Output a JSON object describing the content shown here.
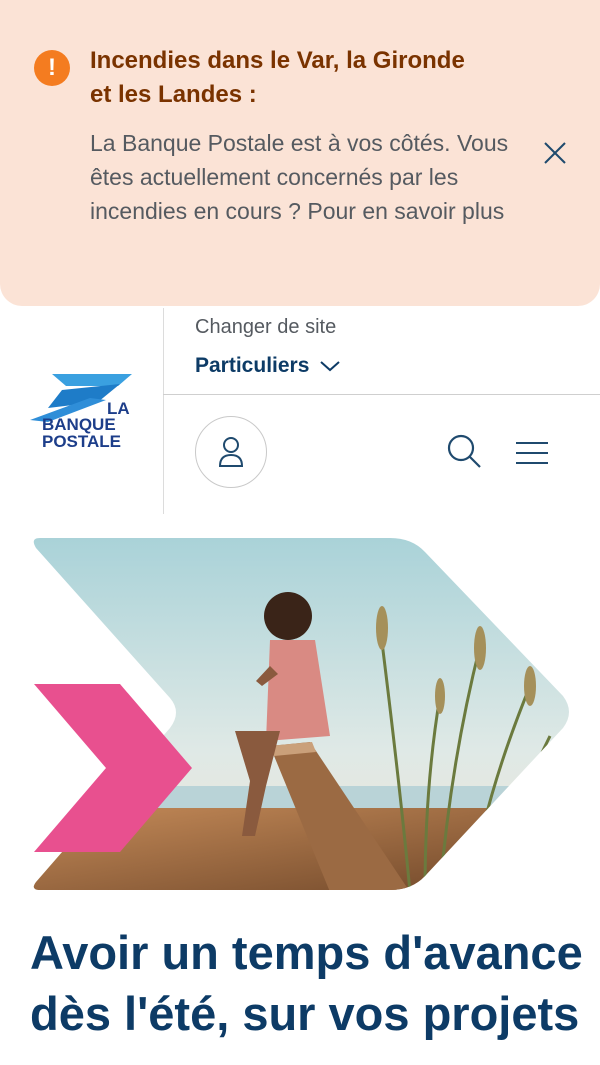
{
  "alert": {
    "icon": "exclamation-icon",
    "icon_glyph": "!",
    "title": "Incendies dans le Var, la Gironde et les Landes :",
    "body": "La Banque Postale est à vos côtés. Vous êtes actuellement concernés par les incendies en cours ? Pour en savoir plus",
    "close_icon": "close-icon",
    "colors": {
      "background": "#fbe3d6",
      "title": "#7a3300",
      "icon": "#f47c20"
    }
  },
  "header": {
    "logo": {
      "line1": "LA",
      "line2": "BANQUE",
      "line3": "POSTALE"
    },
    "change_site_label": "Changer de site",
    "site_selected": "Particuliers",
    "account_icon": "user-icon",
    "search_icon": "search-icon",
    "menu_icon": "hamburger-menu-icon",
    "brand_color": "#0d3b66"
  },
  "hero": {
    "image": "woman-on-boardwalk-photo",
    "accent_color": "#e8508f",
    "headline": "Avoir un temps d'avance dès l'été, sur vos projets"
  }
}
